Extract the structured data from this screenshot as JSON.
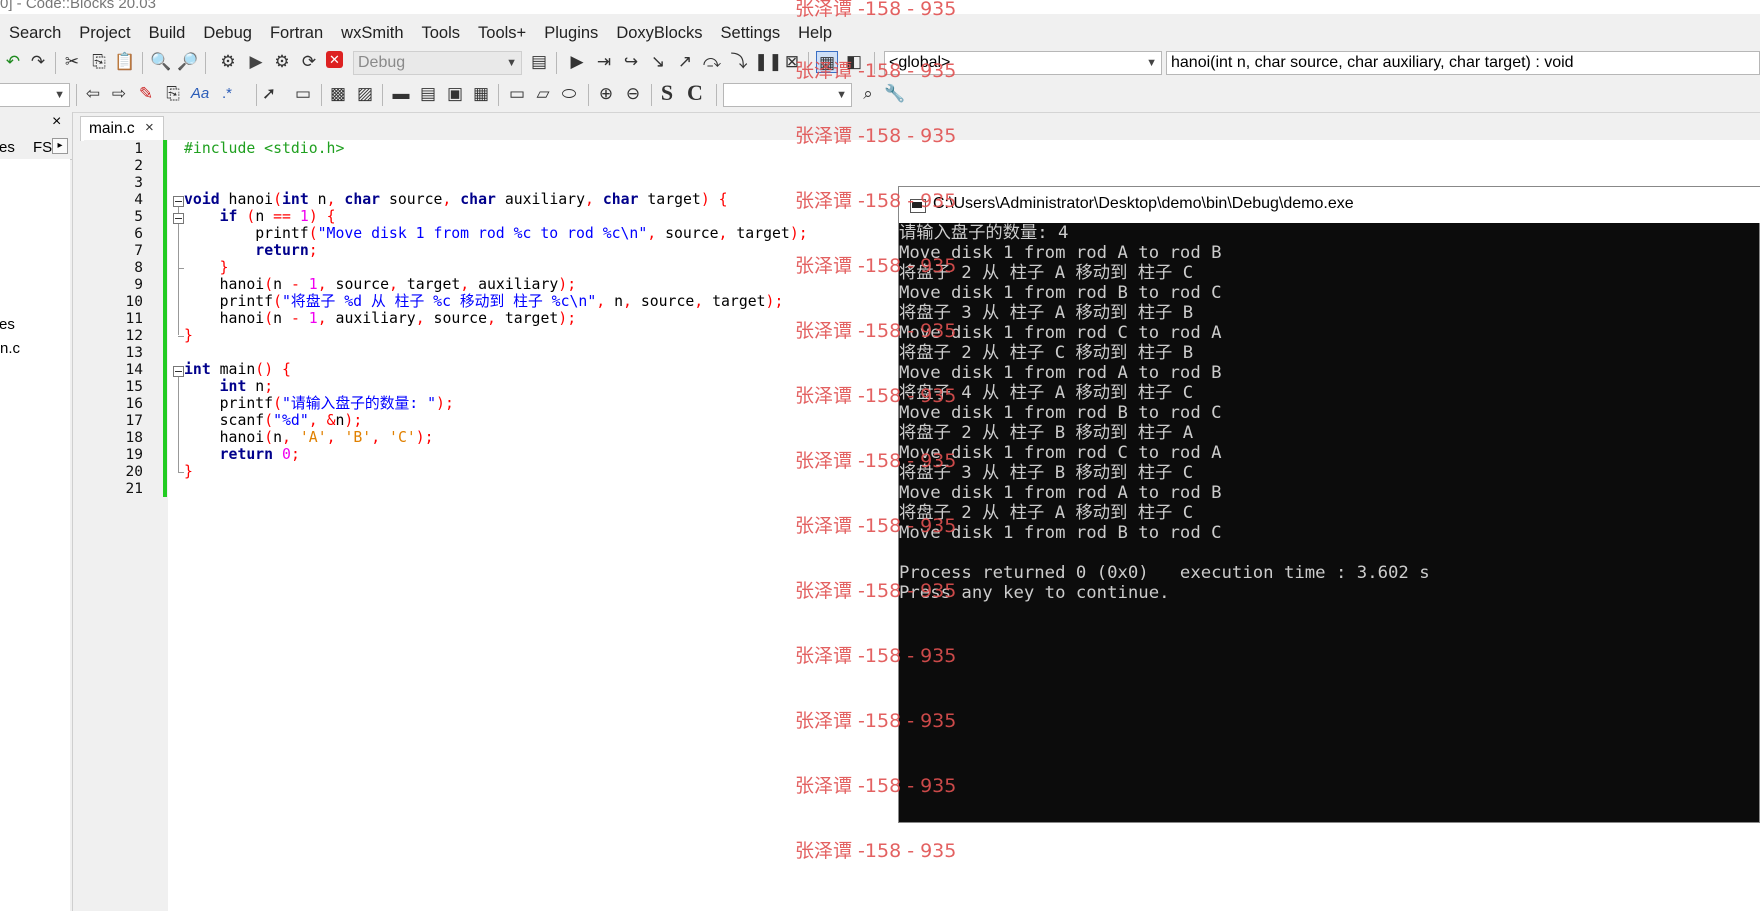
{
  "window": {
    "title": "0] - Code::Blocks 20.03"
  },
  "menu": [
    "Search",
    "Project",
    "Build",
    "Debug",
    "Fortran",
    "wxSmith",
    "Tools",
    "Tools+",
    "Plugins",
    "DoxyBlocks",
    "Settings",
    "Help"
  ],
  "toolbar": {
    "build_target": "Debug",
    "scope": "<global>",
    "function": "hanoi(int n, char source, char auxiliary, char target) : void",
    "toolbar2_combo": "",
    "bold_s": "S",
    "bold_c": "C",
    "aa": "Aa",
    "regex": ".*"
  },
  "left_panel": {
    "close": "×",
    "tab_partial": "es",
    "tab_fs": "FS",
    "tab_arrow": "▸",
    "tree_item_1": "es",
    "tree_item_2": "n.c"
  },
  "editor": {
    "tab_label": "main.c",
    "tab_close": "×",
    "line_numbers": [
      "1",
      "2",
      "3",
      "4",
      "5",
      "6",
      "7",
      "8",
      "9",
      "10",
      "11",
      "12",
      "13",
      "14",
      "15",
      "16",
      "17",
      "18",
      "19",
      "20",
      "21"
    ],
    "code": [
      "#include <stdio.h>",
      "",
      "",
      "void hanoi(int n, char source, char auxiliary, char target) {",
      "    if (n == 1) {",
      "        printf(\"Move disk 1 from rod %c to rod %c\\n\", source, target);",
      "        return;",
      "    }",
      "    hanoi(n - 1, source, target, auxiliary);",
      "    printf(\"将盘子 %d 从 柱子 %c 移动到 柱子 %c\\n\", n, source, target);",
      "    hanoi(n - 1, auxiliary, source, target);",
      "}",
      "",
      "int main() {",
      "    int n;",
      "    printf(\"请输入盘子的数量: \");",
      "    scanf(\"%d\", &n);",
      "    hanoi(n, 'A', 'B', 'C');",
      "    return 0;",
      "}",
      ""
    ]
  },
  "console": {
    "title": "C:\\Users\\Administrator\\Desktop\\demo\\bin\\Debug\\demo.exe",
    "lines": [
      "请输入盘子的数量: 4",
      "Move disk 1 from rod A to rod B",
      "将盘子 2 从 柱子 A 移动到 柱子 C",
      "Move disk 1 from rod B to rod C",
      "将盘子 3 从 柱子 A 移动到 柱子 B",
      "Move disk 1 from rod C to rod A",
      "将盘子 2 从 柱子 C 移动到 柱子 B",
      "Move disk 1 from rod A to rod B",
      "将盘子 4 从 柱子 A 移动到 柱子 C",
      "Move disk 1 from rod B to rod C",
      "将盘子 2 从 柱子 B 移动到 柱子 A",
      "Move disk 1 from rod C to rod A",
      "将盘子 3 从 柱子 B 移动到 柱子 C",
      "Move disk 1 from rod A to rod B",
      "将盘子 2 从 柱子 A 移动到 柱子 C",
      "Move disk 1 from rod B to rod C",
      "",
      "Process returned 0 (0x0)   execution time : 3.602 s",
      "Press any key to continue."
    ]
  },
  "watermark": "张泽谭 -158 - 935",
  "colors": {
    "console_bg": "#0c0c0c",
    "change_bar": "#22cc22",
    "keyword": "#00008b",
    "string": "#0000ff",
    "preprocessor": "#20a020",
    "watermark": "#e05050"
  }
}
